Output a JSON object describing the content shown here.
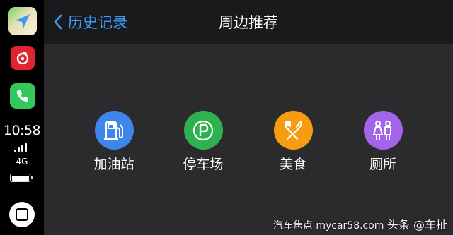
{
  "dock": {
    "apps": [
      {
        "name": "maps-app-icon",
        "color": "#3d9bf5"
      },
      {
        "name": "netease-music-app-icon",
        "color": "#e0232e"
      },
      {
        "name": "phone-app-icon",
        "color": "#34c759"
      }
    ],
    "time": "10:58",
    "network": "4G",
    "signal_bars": 4,
    "battery_level": 1.0
  },
  "header": {
    "back_label": "历史记录",
    "title": "周边推荐"
  },
  "categories": [
    {
      "label": "加油站",
      "icon": "gas-station-icon",
      "color": "#3f86ea"
    },
    {
      "label": "停车场",
      "icon": "parking-icon",
      "color": "#2fb14f"
    },
    {
      "label": "美食",
      "icon": "food-icon",
      "color": "#f59c11"
    },
    {
      "label": "厕所",
      "icon": "restroom-icon",
      "color": "#a264e8"
    }
  ],
  "watermark": {
    "left": "汽车焦点",
    "right": "头条 @车扯",
    "site": "mycar58.com"
  },
  "theme": {
    "accent": "#3d9bf5",
    "background": "#2b2b2d",
    "navbar": "#1a1a1c"
  }
}
